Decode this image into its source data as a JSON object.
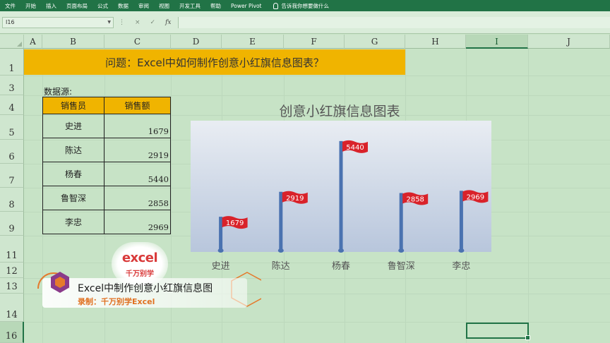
{
  "ribbon": {
    "tabs": [
      "文件",
      "开始",
      "插入",
      "页面布局",
      "公式",
      "数据",
      "审阅",
      "视图",
      "开发工具",
      "帮助",
      "Power Pivot"
    ],
    "tell_me": "告诉我你想要做什么"
  },
  "formula_bar": {
    "name_box": "I16",
    "cancel": "×",
    "enter": "✓",
    "fx": "fx",
    "value": ""
  },
  "columns": [
    "A",
    "B",
    "C",
    "D",
    "E",
    "F",
    "G",
    "H",
    "I",
    "J"
  ],
  "rows": [
    "1",
    "3",
    "4",
    "5",
    "6",
    "7",
    "8",
    "9",
    "11",
    "12",
    "13",
    "14",
    "16"
  ],
  "sheet": {
    "banner": "问题：Excel中如何制作创意小红旗信息图表？",
    "source_label": "数据源:",
    "table": {
      "headers": [
        "销售员",
        "销售额"
      ],
      "rows": [
        {
          "name": "史进",
          "value": "1679"
        },
        {
          "name": "陈达",
          "value": "2919"
        },
        {
          "name": "杨春",
          "value": "5440"
        },
        {
          "name": "鲁智深",
          "value": "2858"
        },
        {
          "name": "李忠",
          "value": "2969"
        }
      ]
    }
  },
  "chart_data": {
    "type": "bar",
    "title": "创意小红旗信息图表",
    "categories": [
      "史进",
      "陈达",
      "杨春",
      "鲁智深",
      "李忠"
    ],
    "values": [
      1679,
      2919,
      5440,
      2858,
      2969
    ],
    "ylim": [
      0,
      6000
    ],
    "grid": false,
    "colors": {
      "pole": "#4a72b0",
      "flag": "#d9222a",
      "plot_top": "#e9edf3",
      "plot_bottom": "#b8c6dc"
    }
  },
  "watermark": {
    "line1": "excel",
    "line2": "千万别学"
  },
  "caption": {
    "title": "Excel中制作创意小红旗信息图",
    "subtitle": "录制：千万别学Excel"
  },
  "colors": {
    "ribbon": "#217346",
    "banner": "#f0b400",
    "sheet_bg": "#c7e3c6"
  }
}
